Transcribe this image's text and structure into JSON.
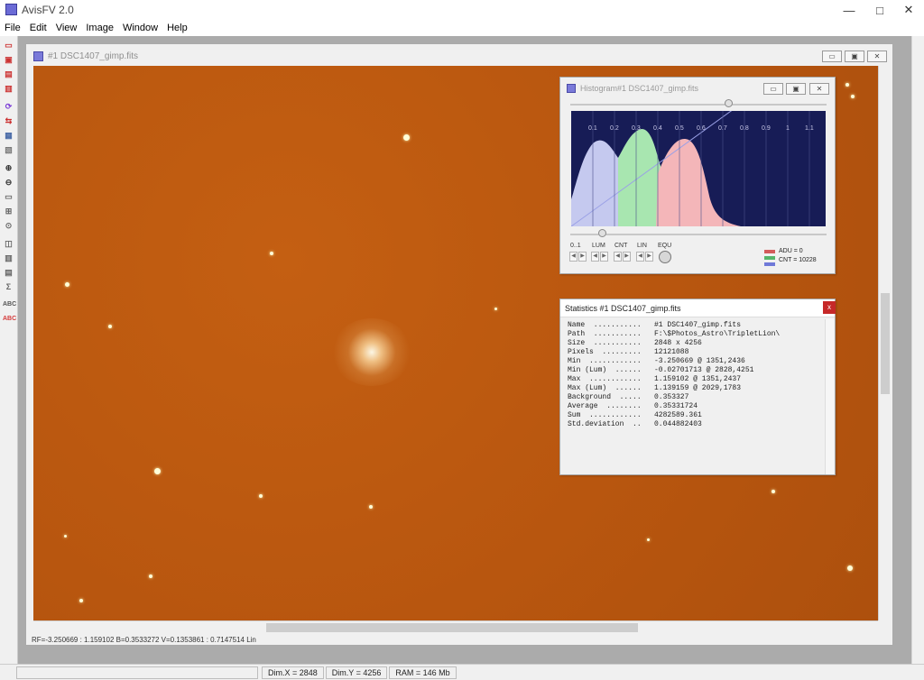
{
  "app": {
    "title": "AvisFV 2.0",
    "window_controls": [
      "—",
      "□",
      "✕"
    ]
  },
  "menu": [
    "File",
    "Edit",
    "View",
    "Image",
    "Window",
    "Help"
  ],
  "toolbar": {
    "icons": [
      "open-folder-icon",
      "save-icon",
      "save-as-icon",
      "folder-icon",
      "refresh-icon",
      "duplicate-icon",
      "copy-icon",
      "paste-icon",
      "zoom-in-icon",
      "zoom-out-icon",
      "display-icon",
      "fit-icon",
      "target-icon",
      "crop-icon",
      "histogram-icon",
      "statistics-icon",
      "sigma-icon",
      "text-icon",
      "text-alt-icon"
    ]
  },
  "document": {
    "title": "#1 DSC1407_gimp.fits",
    "status_line": "RF=-3.250669 : 1.159102  B=0.3533272  V=0.1353861 : 0.7147514 Lin"
  },
  "histogram": {
    "title": "Histogram#1 DSC1407_gimp.fits",
    "ticks": [
      "0.1",
      "0.2",
      "0.3",
      "0.4",
      "0.5",
      "0.6",
      "0.7",
      "0.8",
      "0.9",
      "1",
      "1.1"
    ],
    "controls": [
      "0..1",
      "LUM",
      "CNT",
      "LIN",
      "EQU"
    ],
    "adu_line": "ADU = 0",
    "cnt_line": "CNT = 10228",
    "colors": {
      "background": "#171c56",
      "red": "#f4b6b9",
      "green": "#a8e6b0",
      "blue": "#c5c9ef"
    }
  },
  "statistics": {
    "title": "Statistics #1 DSC1407_gimp.fits",
    "rows": [
      {
        "label": "Name  ...........",
        "value": "#1 DSC1407_gimp.fits"
      },
      {
        "label": "Path  ...........",
        "value": "F:\\$Photos_Astro\\TripletLion\\"
      },
      {
        "label": "Size  ...........",
        "value": "2848 x 4256"
      },
      {
        "label": "Pixels  .........",
        "value": "12121088"
      },
      {
        "label": "Min  ............",
        "value": "-3.250669 @ 1351,2436"
      },
      {
        "label": "Min (Lum)  ......",
        "value": "-0.02701713 @ 2828,4251"
      },
      {
        "label": "Max  ............",
        "value": "1.159102 @ 1351,2437"
      },
      {
        "label": "Max (Lum)  ......",
        "value": "1.139159 @ 2029,1783"
      },
      {
        "label": "Background  .....",
        "value": "0.353327"
      },
      {
        "label": "Average  ........",
        "value": "0.35331724"
      },
      {
        "label": "Sum  ............",
        "value": "4282589.361"
      },
      {
        "label": "Std.deviation  ..",
        "value": "0.044882403"
      }
    ]
  },
  "statusbar": {
    "dimx": "Dim.X = 2848",
    "dimy": "Dim.Y = 4256",
    "ram": "RAM = 146 Mb"
  }
}
